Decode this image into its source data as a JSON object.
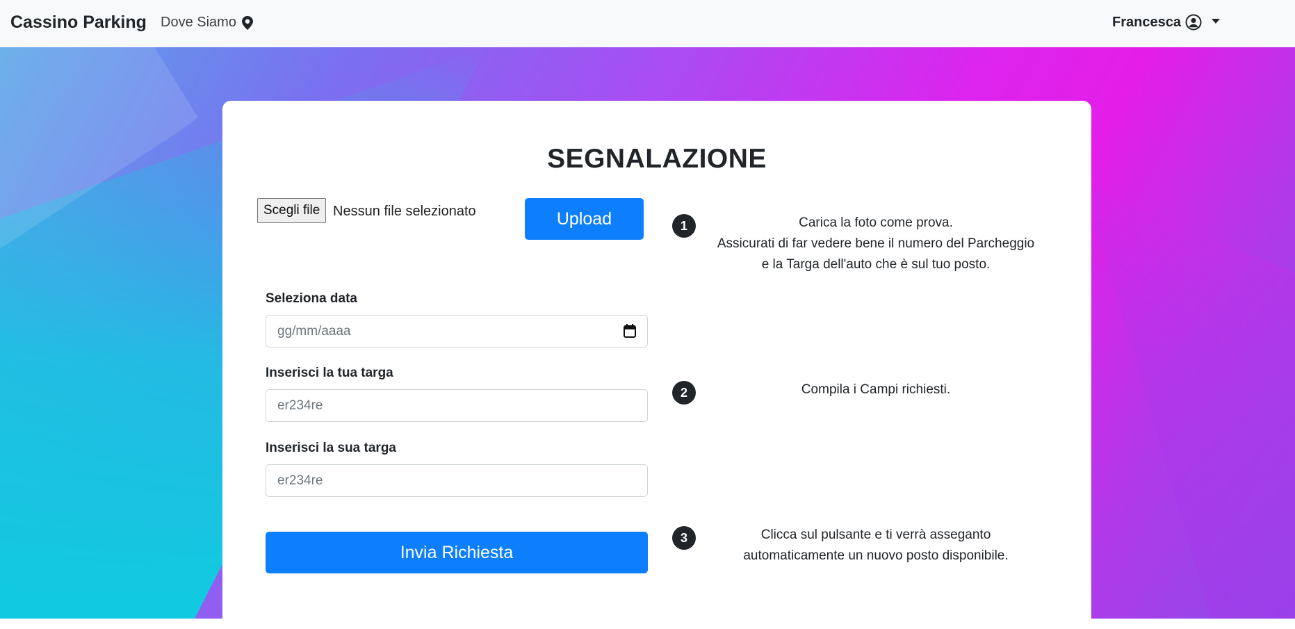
{
  "navbar": {
    "brand": "Cassino Parking",
    "nav_link": "Dove Siamo",
    "user_name": "Francesca"
  },
  "form": {
    "title": "SEGNALAZIONE",
    "file_button": "Scegli file",
    "file_status": "Nessun file selezionato",
    "upload_label": "Upload",
    "date_label": "Seleziona data",
    "date_placeholder": "gg/mm/aaaa",
    "my_plate_label": "Inserisci la tua targa",
    "my_plate_placeholder": "er234re",
    "their_plate_label": "Inserisci la sua targa",
    "their_plate_placeholder": "er234re",
    "submit_label": "Invia Richiesta"
  },
  "steps": [
    {
      "number": "1",
      "lines": [
        "Carica la foto come prova.",
        "Assicurati di far vedere bene il numero del Parcheggio",
        "e la Targa dell'auto che è sul tuo posto."
      ]
    },
    {
      "number": "2",
      "lines": [
        "Compila i Campi richiesti."
      ]
    },
    {
      "number": "3",
      "lines": [
        "Clicca sul pulsante e ti verrà asseganto",
        "automaticamente un nuovo posto disponibile."
      ]
    }
  ],
  "colors": {
    "primary": "#0d7ffc",
    "navbar_bg": "#f8f9fa",
    "text": "#212529"
  },
  "icons": {
    "location": "map-pin-icon",
    "user": "user-circle-icon",
    "dropdown": "caret-down-icon",
    "calendar": "calendar-icon"
  }
}
